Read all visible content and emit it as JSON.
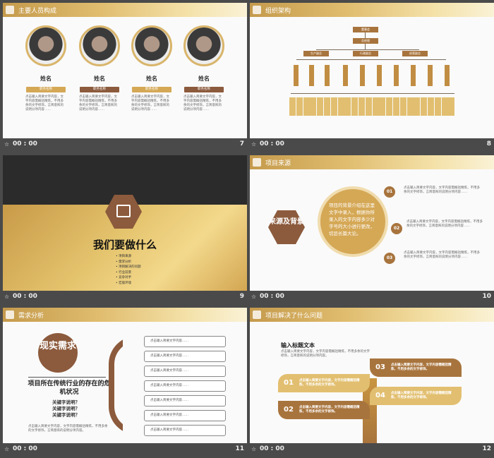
{
  "slides": [
    {
      "number": "7",
      "time": "00 : 00",
      "header": "主要人员构成",
      "people": [
        {
          "name": "姓名",
          "role": "职务名称",
          "desc": "点击输入简要文字内容，文字内容需概括精炼，不用多余的文字修饰，言简意赅的说明分项内容……"
        },
        {
          "name": "姓名",
          "role": "职务名称",
          "desc": "点击输入简要文字内容，文字内容需概括精炼，不用多余的文字修饰，言简意赅的说明分项内容……"
        },
        {
          "name": "姓名",
          "role": "职务名称",
          "desc": "点击输入简要文字内容，文字内容需概括精炼，不用多余的文字修饰，言简意赅的说明分项内容……"
        },
        {
          "name": "姓名",
          "role": "职务名称",
          "desc": "点击输入简要文字内容，文字内容需概括精炼，不用多余的文字修饰，言简意赅的说明分项内容……"
        }
      ]
    },
    {
      "number": "8",
      "time": "00 : 00",
      "header": "组织架构",
      "org": {
        "top": "董事会",
        "second": "总经理",
        "branches": [
          "生产副总",
          "行政副总",
          "经营副总"
        ]
      }
    },
    {
      "number": "9",
      "time": "00 : 00",
      "title": "我们要做什么",
      "items": [
        "项目来源",
        "需求分析",
        "项目解决的问题",
        "行业前景",
        "竞争对手",
        "宏观环境"
      ]
    },
    {
      "number": "10",
      "time": "00 : 00",
      "header": "项目来源",
      "hex": "来源及背景",
      "circle": "项目的背景介绍在这里文字中录入，根据你所录入的文字内容多少对字号的大小进行更改，切忌长篇大论。",
      "points": [
        {
          "num": "01",
          "text": "点击输入简要文字内容，文字内容需概括精炼，不用多余的文字修饰，言简意赅的说明分项内容……"
        },
        {
          "num": "02",
          "text": "点击输入简要文字内容，文字内容需概括精炼，不用多余的文字修饰，言简意赅的说明分项内容……"
        },
        {
          "num": "03",
          "text": "点击输入简要文字内容，文字内容需概括精炼，不用多余的文字修饰，言简意赅的说明分项内容……"
        }
      ]
    },
    {
      "number": "11",
      "time": "00 : 00",
      "header": "需求分析",
      "circle": "现实需求",
      "subtitle": "项目所在传统行业的存在的危机状况",
      "keywords": [
        "关键字说明？",
        "关键字说明？",
        "关键字说明？"
      ],
      "desc": "点击输入简要文字内容，文字内容需概括精炼，不用多余的文字修饰，言简意赅的说明分项内容。",
      "boxes": [
        "点击输入简要文字内容……",
        "点击输入简要文字内容……",
        "点击输入简要文字内容……",
        "点击输入简要文字内容……",
        "点击输入简要文字内容……",
        "点击输入简要文字内容……",
        "点击输入简要文字内容……"
      ]
    },
    {
      "number": "12",
      "time": "00 : 00",
      "header": "项目解决了什么问题",
      "title": "输入标题文本",
      "desc": "点击输入简要文字内容，文字内容需概括精炼，不用多余的文字修饰，言简意赅的说明分项内容。",
      "leaves": [
        {
          "num": "01",
          "text": "点击输入简要文字内容，文字内容需概括精炼，不用多余的文字修饰。"
        },
        {
          "num": "02",
          "text": "点击输入简要文字内容，文字内容需概括精炼，不用多余的文字修饰。"
        },
        {
          "num": "03",
          "text": "点击输入简要文字内容，文字内容需概括精炼，不用多余的文字修饰。"
        },
        {
          "num": "04",
          "text": "点击输入简要文字内容，文字内容需概括精炼，不用多余的文字修饰。"
        }
      ]
    }
  ],
  "colors": {
    "brown": "#8c5a3c",
    "gold": "#d5a856",
    "dark": "#2b2b2b"
  }
}
